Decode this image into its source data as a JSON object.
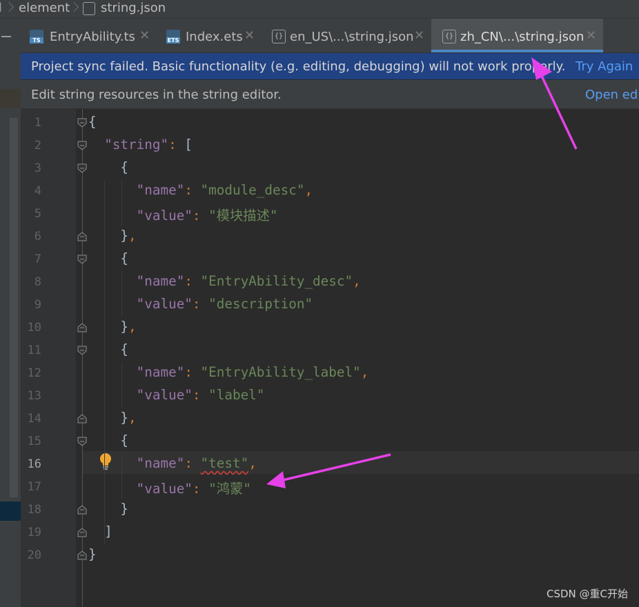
{
  "breadcrumb": {
    "items": [
      "element",
      "string.json"
    ]
  },
  "tabs": [
    {
      "label": "EntryAbility.ts",
      "icon": "ts-file-icon",
      "icon_text": "TS",
      "active": false
    },
    {
      "label": "Index.ets",
      "icon": "ets-file-icon",
      "icon_text": "ETS",
      "active": false
    },
    {
      "label": "en_US\\...\\string.json",
      "icon": "json-file-icon",
      "icon_text": "{}",
      "active": false
    },
    {
      "label": "zh_CN\\...\\string.json",
      "icon": "json-file-icon",
      "icon_text": "{}",
      "active": true
    }
  ],
  "sync_banner": {
    "message": "Project sync failed. Basic functionality (e.g. editing, debugging) will not work properly.",
    "action": "Try Again",
    "color": "#214283"
  },
  "editor_banner": {
    "message": "Edit string resources in the string editor.",
    "action": "Open editor"
  },
  "editor": {
    "current_line": 16,
    "lines": [
      {
        "n": "1",
        "text": "{"
      },
      {
        "n": "2",
        "text": "  \"string\": ["
      },
      {
        "n": "3",
        "text": "    {"
      },
      {
        "n": "4",
        "text": "      \"name\": \"module_desc\","
      },
      {
        "n": "5",
        "text": "      \"value\": \"模块描述\""
      },
      {
        "n": "6",
        "text": "    },"
      },
      {
        "n": "7",
        "text": "    {"
      },
      {
        "n": "8",
        "text": "      \"name\": \"EntryAbility_desc\","
      },
      {
        "n": "9",
        "text": "      \"value\": \"description\""
      },
      {
        "n": "10",
        "text": "    },"
      },
      {
        "n": "11",
        "text": "    {"
      },
      {
        "n": "12",
        "text": "      \"name\": \"EntryAbility_label\","
      },
      {
        "n": "13",
        "text": "      \"value\": \"label\""
      },
      {
        "n": "14",
        "text": "    },"
      },
      {
        "n": "15",
        "text": "    {"
      },
      {
        "n": "16",
        "text": "      \"name\": \"test\","
      },
      {
        "n": "17",
        "text": "      \"value\": \"鸿蒙\""
      },
      {
        "n": "18",
        "text": "    }"
      },
      {
        "n": "19",
        "text": "  ]"
      },
      {
        "n": "20",
        "text": "}"
      }
    ]
  },
  "colors": {
    "key": "#9876aa",
    "string": "#6a8759",
    "punct": "#cc7832",
    "annotation_arrow": "#e641e8",
    "active_tab_underline": "#4a88c7"
  },
  "watermark": "CSDN @重C开始"
}
